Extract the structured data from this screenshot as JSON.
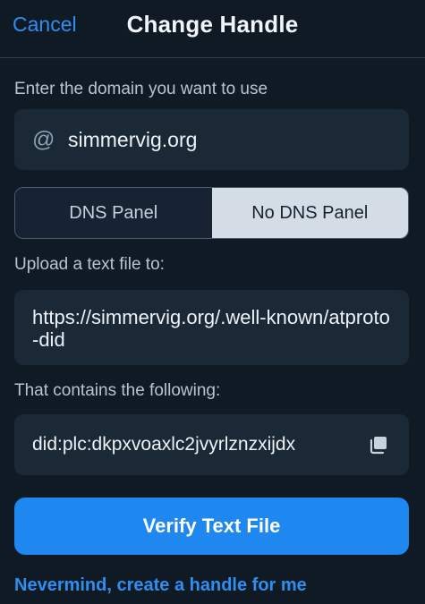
{
  "header": {
    "cancel_label": "Cancel",
    "title": "Change Handle"
  },
  "domain": {
    "label": "Enter the domain you want to use",
    "at_symbol": "@",
    "value": "simmervig.org"
  },
  "tabs": [
    {
      "label": "DNS Panel",
      "selected": false
    },
    {
      "label": "No DNS Panel",
      "selected": true
    }
  ],
  "upload": {
    "label": "Upload a text file to:",
    "url": "https://simmervig.org/.well-known/atproto-did"
  },
  "contents": {
    "label": "That contains the following:",
    "did": "did:plc:dkpxvoaxlc2jvyrlznzxijdx",
    "copy_icon": "copy-icon"
  },
  "verify_button_label": "Verify Text File",
  "nevermind_link": "Nevermind, create a handle for me",
  "colors": {
    "background": "#0f1a25",
    "accent": "#1e87f0",
    "link": "#2e8ff0",
    "field_bg": "#1b2836",
    "selected_tab_bg": "#d4dde6"
  }
}
